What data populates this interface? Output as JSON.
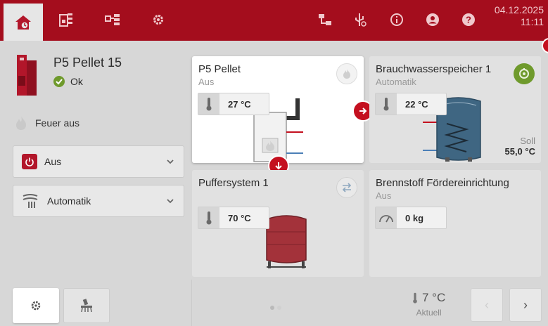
{
  "topbar": {
    "date": "04.12.2025",
    "time": "11:11",
    "icons": [
      "home-icon",
      "heating-panel-icon",
      "distribution-icon",
      "gear-icon",
      "network-icon",
      "usb-icon",
      "info-icon",
      "user-icon",
      "help-icon"
    ]
  },
  "device": {
    "name": "P5 Pellet 15",
    "status": "Ok",
    "fire": "Feuer aus"
  },
  "selects": {
    "mode": "Aus",
    "program": "Automatik"
  },
  "cards": {
    "boiler": {
      "title": "P5 Pellet",
      "subtitle": "Aus",
      "temp": "27 °C"
    },
    "dhw": {
      "title": "Brauchwasserspeicher 1",
      "subtitle": "Automatik",
      "temp": "22 °C",
      "soll_label": "Soll",
      "soll_value": "55,0 °C"
    },
    "buffer": {
      "title": "Puffersystem 1",
      "temp": "70 °C"
    },
    "fuel": {
      "title": "Brennstoff Fördereinrichtung",
      "subtitle": "Aus",
      "weight": "0 kg"
    }
  },
  "footer": {
    "outside_temp": "7 °C",
    "outside_label": "Aktuell",
    "prev": "‹",
    "next": "›"
  },
  "colors": {
    "brand": "#a40d1d",
    "accent_red": "#c4101f",
    "green": "#6f9a2c"
  }
}
